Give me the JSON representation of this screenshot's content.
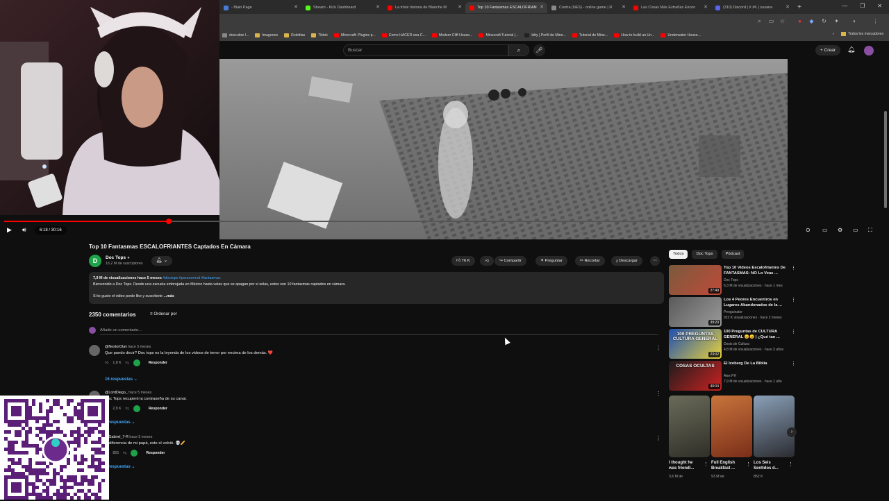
{
  "tabs": [
    {
      "title": "- Main Page",
      "color": "#4a7bd8"
    },
    {
      "title": "Stream - Kick Dashboard",
      "color": "#53fc18"
    },
    {
      "title": "La triste historia de Blanche M",
      "color": "#ff0000"
    },
    {
      "title": "Top 10 Fantasmas ESCALOFRIAN",
      "color": "#ff0000",
      "active": true
    },
    {
      "title": "Contra (NES) - online game | R",
      "color": "#888888"
    },
    {
      "title": "Las Cosas Más Extrañas Encon",
      "color": "#ff0000"
    },
    {
      "title": "(310) Discord | # 🎮 | susana",
      "color": "#5865f2"
    }
  ],
  "bookmarks": [
    {
      "label": "descubre l...",
      "color": "#888888"
    },
    {
      "label": "Imagenes",
      "color": "#d9b44a"
    },
    {
      "label": "Ruletitas",
      "color": "#d9b44a"
    },
    {
      "label": "Tiktok",
      "color": "#d9b44a"
    },
    {
      "label": "Minecraft: Plugins p...",
      "color": "#ff0000"
    },
    {
      "label": "Como HACER una C...",
      "color": "#ff0000"
    },
    {
      "label": "Modern Cliff House...",
      "color": "#ff0000"
    },
    {
      "label": "Minecraft Tutorial |...",
      "color": "#ff0000"
    },
    {
      "label": "kitty | Perfil de Mine...",
      "color": "#222222"
    },
    {
      "label": "Tutorial de Mine...",
      "color": "#ff0000"
    },
    {
      "label": "How to build an Un...",
      "color": "#ff0000"
    },
    {
      "label": "Underwater House...",
      "color": "#ff0000"
    }
  ],
  "bookmarks_all": "Todos los marcadores",
  "header": {
    "search_placeholder": "Buscar",
    "create": "Crear"
  },
  "player": {
    "time": "6:18 / 30:16",
    "progress": 0.21
  },
  "video": {
    "title": "Top 10 Fantasmas ESCALOFRIANTES Captados En Cámara",
    "channel": "Doc Tops",
    "subscribers": "16,2 M de suscriptores",
    "likes": "76 K",
    "share": "Compartir",
    "ask": "Preguntar",
    "clip": "Recortar",
    "download": "Descargar"
  },
  "description": {
    "stats": "7,9 M de visualizaciones  hace 5 meses",
    "tags": "#doctops #paranormal #fantasmas",
    "line1": "Bienvenido a Doc Tops.  Desde una escuela embrujada en México hasta velas que se apagan por si solas, estos son 10 fantasmas captados en cámara.",
    "line2": "Si te gusto el video ponle like y suscribete",
    "more": "...más"
  },
  "comments_header": {
    "count": "2350 comentarios",
    "sort": "Ordenar por",
    "add": "Añade un comentario..."
  },
  "comments": [
    {
      "user": "@NestorOlav",
      "time": "hace 5 meses",
      "text": "Que puedo decir? Doc tops es la leyenda de los videos de terror por encima de los demás. ❤️",
      "likes": "1,8 K",
      "reply": "Responder",
      "replies": "16 respuestas"
    },
    {
      "user": "@LordDiego_",
      "time": "hace 5 meses",
      "text": "Doc Tops recuperó la contraseña de su canal.",
      "likes": "2,9 K",
      "reply": "Responder",
      "replies": "8 respuestas"
    },
    {
      "user": "@Gabriel_7-R",
      "time": "hace 5 meses",
      "text": "la diferencia de mi papá, este sí volvió. 💀🥖",
      "likes": "825",
      "reply": "Responder",
      "replies": "6 respuestas"
    }
  ],
  "chips": [
    "Todos",
    "Doc Tops",
    "Pódcast"
  ],
  "recs": [
    {
      "title": "Top 10 Videos Escalofriantes De FANTASMAS: NO Lo Veas ...",
      "channel": "Doc Tops",
      "meta": "6,3 M de visualizaciones · hace 1 mes",
      "dur": "27:49",
      "c1": "#7a5a3c",
      "c2": "#c04a3a"
    },
    {
      "title": "Los 4 Peores Encuentros en Lugares Abandonados de la ...",
      "channel": "Penguinator",
      "meta": "922 K visualizaciones · hace 2 meses",
      "dur": "39:20",
      "c1": "#5a5a5a",
      "c2": "#9a9a9a"
    },
    {
      "title": "100 Preguntas de CULTURA GENERAL 😊😊 | ¿Qué tan ...",
      "channel": "Dosis de Cultura",
      "meta": "4,8 M de visualizaciones · hace 3 años",
      "dur": "23:02",
      "c1": "#1f4fb3",
      "c2": "#e8d23a",
      "thumb_text": "100 PREGUNTAS CULTURA GENERAL"
    },
    {
      "title": "El Iceberg De La Biblia",
      "channel": "Alex PH",
      "meta": "7,9 M de visualizaciones · hace 1 año",
      "dur": "40:04",
      "c1": "#1c1c1c",
      "c2": "#c22",
      "thumb_text": "COSAS OCULTAS"
    }
  ],
  "shorts": [
    {
      "title": "I thought he was friendl...",
      "views": "3,6 M de",
      "c1": "#6b6b5a",
      "c2": "#2f2f28"
    },
    {
      "title": "Full English Breakfast ...",
      "views": "93 M de",
      "c1": "#c8743c",
      "c2": "#7a2e18"
    },
    {
      "title": "Los Seis Sentidos d...",
      "views": "852 K",
      "c1": "#8aa0b8",
      "c2": "#2b2b30"
    }
  ]
}
